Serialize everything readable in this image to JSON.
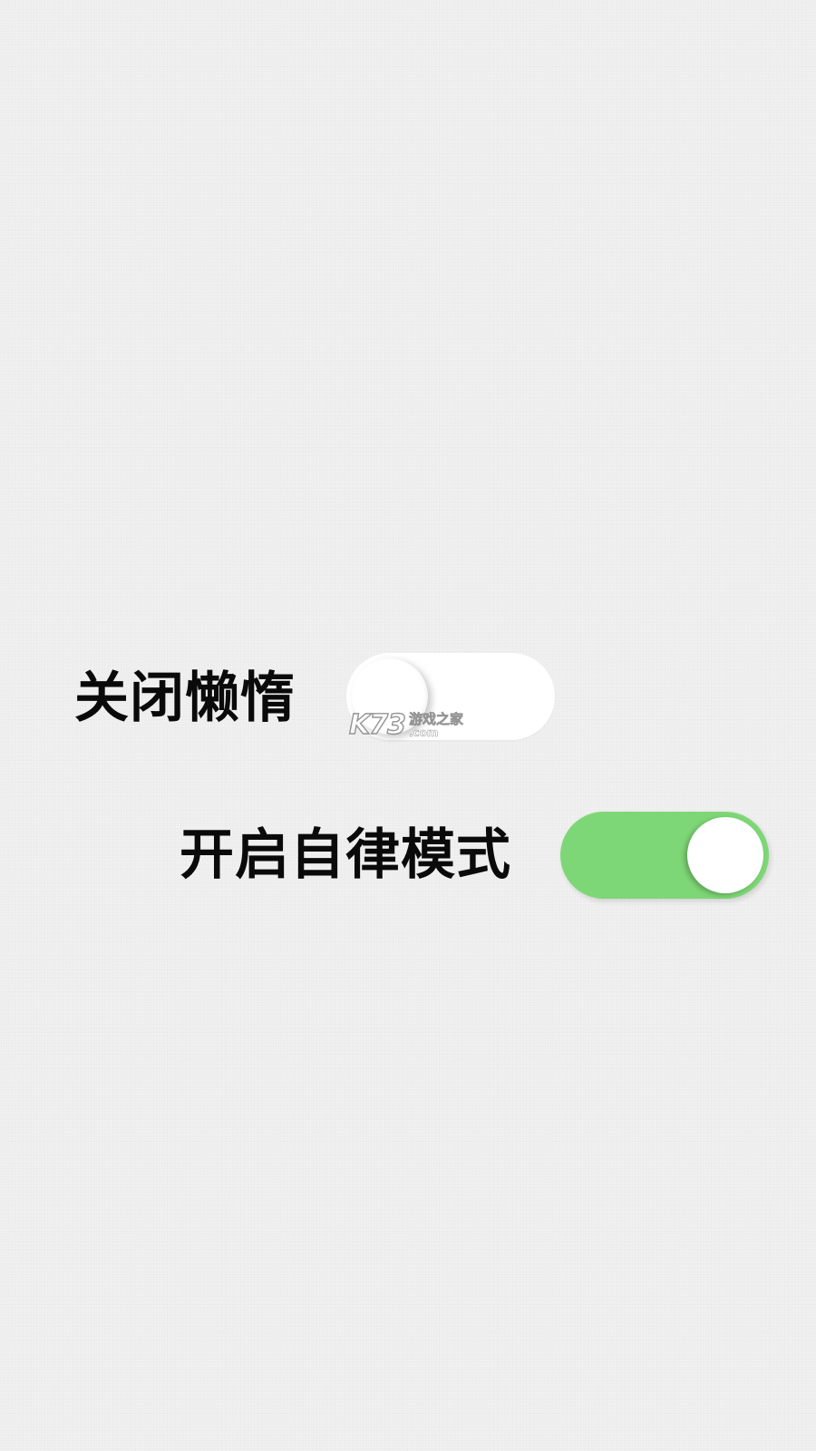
{
  "toggles": [
    {
      "label": "关闭懒惰",
      "state": "off"
    },
    {
      "label": "开启自律模式",
      "state": "on"
    }
  ],
  "colors": {
    "toggle_on": "#7ed776",
    "toggle_off": "#ffffff",
    "knob": "#ffffff",
    "label": "#0a0a0a",
    "background": "#efefef"
  },
  "watermark": {
    "logo": "K73",
    "text": "游戏之家",
    "domain": ".com"
  }
}
